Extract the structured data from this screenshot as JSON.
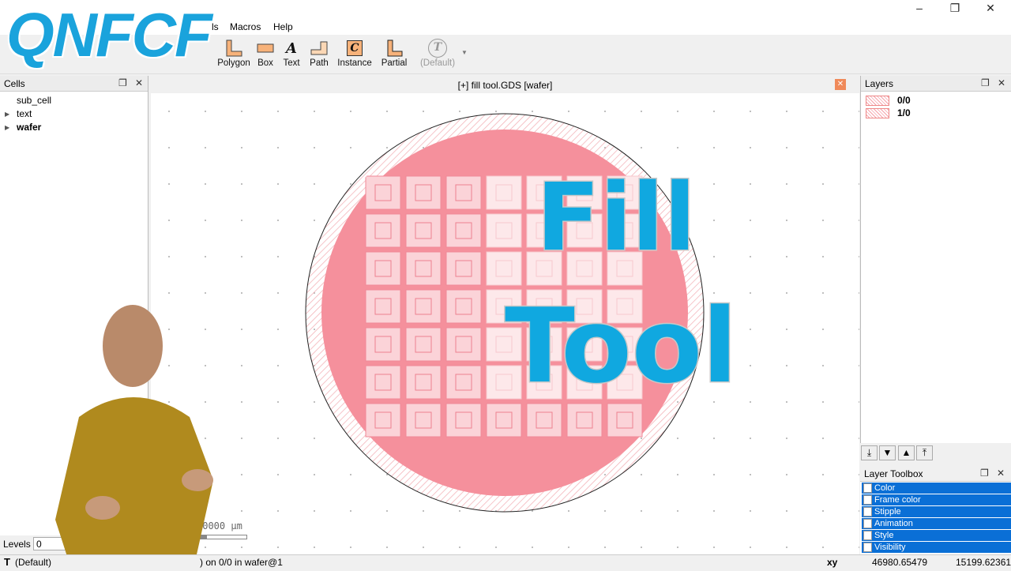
{
  "logo": "QNFCF",
  "menu": [
    "ls",
    "Macros",
    "Help"
  ],
  "window_controls": [
    "minimize",
    "restore",
    "close"
  ],
  "toolbar": {
    "tools": [
      "Polygon",
      "Box",
      "Text",
      "Path",
      "Instance",
      "Partial"
    ],
    "text_style": "(Default)"
  },
  "cells": {
    "title": "Cells",
    "items": [
      "sub_cell",
      "text",
      "wafer"
    ]
  },
  "canvas": {
    "title": "[+] fill tool.GDS [wafer]",
    "scale": "20000 µm"
  },
  "overlay": {
    "line1": "Fill",
    "line2": "Tool"
  },
  "layers": {
    "title": "Layers",
    "items": [
      "0/0",
      "1/0"
    ]
  },
  "layer_toolbox": {
    "title": "Layer Toolbox",
    "rows": [
      "Color",
      "Frame color",
      "Stipple",
      "Animation",
      "Style",
      "Visibility"
    ]
  },
  "levels": {
    "label": "Levels",
    "value": "0",
    "more": ".."
  },
  "status": {
    "mode": "(Default)",
    "message": ") on 0/0 in wafer@1",
    "coord_mode": "xy",
    "x": "46980.65479",
    "y": "15199.62361"
  },
  "colors": {
    "accent": "#0a6fd6",
    "wafer_fill": "#f5909c",
    "title_blue": "#10a8e0"
  }
}
